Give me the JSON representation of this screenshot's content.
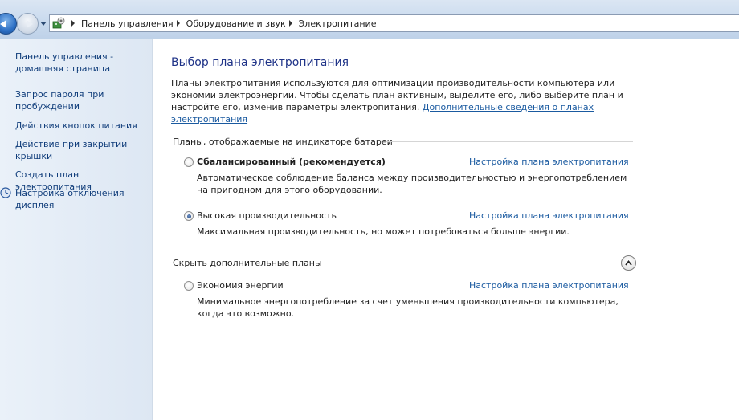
{
  "breadcrumb": [
    "Панель управления",
    "Оборудование и звук",
    "Электропитание"
  ],
  "sidebar": {
    "items": [
      "Панель управления - домашняя страница",
      "Запрос пароля при пробуждении",
      "Действия кнопок питания",
      "Действие при закрытии крышки",
      "Создать план электропитания",
      "Настройка отключения дисплея"
    ]
  },
  "main": {
    "title": "Выбор плана электропитания",
    "description": "Планы электропитания используются для оптимизации производительности компьютера или экономии электроэнергии. Чтобы сделать план активным, выделите его, либо выберите план и настройте его, изменив параметры электропитания.",
    "description_link": "Дополнительные сведения о планах электропитания",
    "group_battery": "Планы, отображаемые на индикаторе батареи",
    "group_hidden": "Скрыть дополнительные планы",
    "plan_link_label": "Настройка плана электропитания",
    "plans": [
      {
        "name": "Сбалансированный (рекомендуется)",
        "desc": "Автоматическое соблюдение баланса между производительностью и энергопотреблением на пригодном для этого оборудовании.",
        "selected": false
      },
      {
        "name": "Высокая производительность",
        "desc": "Максимальная производительность, но может потребоваться больше энергии.",
        "selected": true
      },
      {
        "name": "Экономия энергии",
        "desc": "Минимальное энергопотребление за счет уменьшения производительности компьютера, когда это возможно.",
        "selected": false
      }
    ]
  },
  "colors": {
    "link": "#1a5aa0",
    "title": "#1e3287",
    "nav_link": "#0f3c7a"
  }
}
